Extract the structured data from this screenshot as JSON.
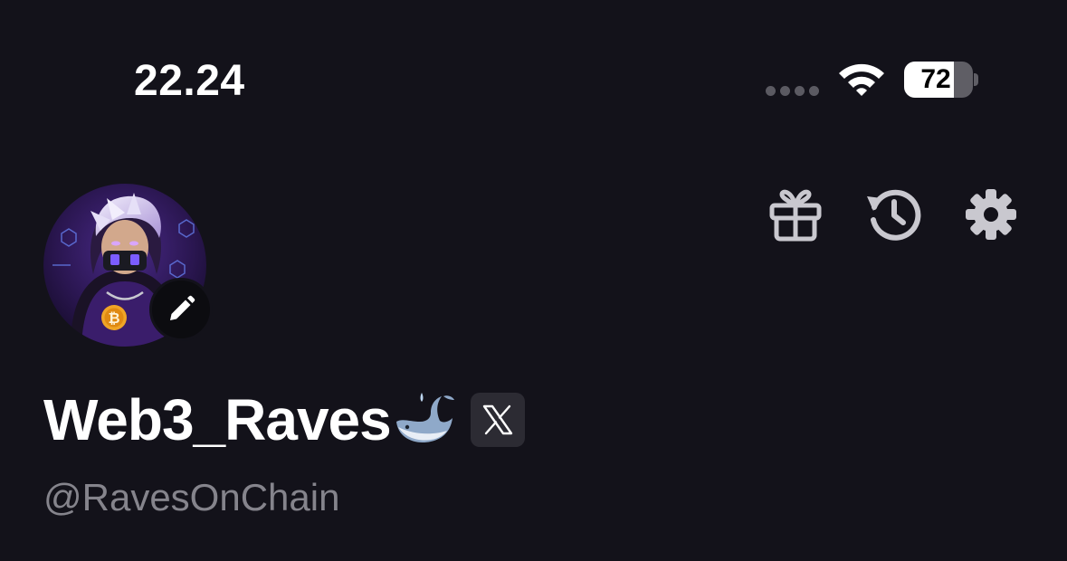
{
  "status_bar": {
    "time": "22.24",
    "battery_level": "72",
    "battery_fraction": 0.72
  },
  "header": {
    "actions": [
      {
        "icon": "gift-icon"
      },
      {
        "icon": "history-icon"
      },
      {
        "icon": "gear-icon"
      }
    ]
  },
  "profile": {
    "display_name": "Web3_Raves",
    "name_emoji_icon": "whale-icon",
    "social_badge_icon": "x-logo-icon",
    "handle": "@RavesOnChain",
    "avatar_edit_icon": "pencil-icon"
  },
  "colors": {
    "background": "#13121a",
    "muted_text": "#85848c",
    "icon_gray": "#c9c8cf"
  }
}
